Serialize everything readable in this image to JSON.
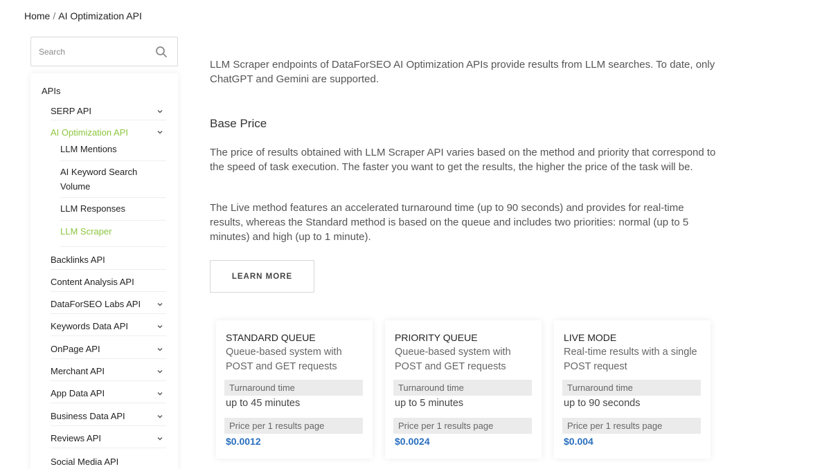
{
  "breadcrumb": {
    "home": "Home",
    "separator": "/",
    "current": "AI Optimization API"
  },
  "search": {
    "placeholder": "Search",
    "icon": "search-icon"
  },
  "sidebar": {
    "root": "APIs",
    "items": [
      {
        "label": "SERP API",
        "chevron": true
      },
      {
        "label": "AI Optimization API",
        "chevron": true,
        "active": true
      },
      {
        "label": "Backlinks API",
        "chevron": false
      },
      {
        "label": "Content Analysis API",
        "chevron": false
      },
      {
        "label": "DataForSEO Labs API",
        "chevron": true
      },
      {
        "label": "Keywords Data API",
        "chevron": true
      },
      {
        "label": "OnPage API",
        "chevron": true
      },
      {
        "label": "Merchant API",
        "chevron": true
      },
      {
        "label": "App Data API",
        "chevron": true
      },
      {
        "label": "Business Data API",
        "chevron": true
      },
      {
        "label": "Reviews API",
        "chevron": true
      },
      {
        "label": "Social Media API",
        "chevron": false
      }
    ],
    "subitems": [
      {
        "label": "LLM Mentions"
      },
      {
        "label": "AI Keyword Search Volume"
      },
      {
        "label": "LLM Responses"
      },
      {
        "label": "LLM Scraper",
        "active": true
      }
    ]
  },
  "main": {
    "intro": "LLM Scraper endpoints of DataForSEO AI Optimization APIs provide results from LLM searches. To date, only ChatGPT and Gemini are supported.",
    "heading": "Base Price",
    "paragraph1": "The price of results obtained with LLM Scraper API varies based on the method and priority that correspond to the speed of task execution. The faster you want to get the results, the higher the price of the task will be.",
    "paragraph2": "The Live method features an accelerated turnaround time (up to 90 seconds) and provides for real-time results, whereas the Standard method is based on the queue and includes two priorities: normal (up to 5 minutes) and high (up to 1 minute).",
    "learn_more": "LEARN MORE"
  },
  "cards": [
    {
      "title": "STANDARD QUEUE",
      "desc": "Queue-based system with POST and GET requests",
      "turnaround_label": "Turnaround time",
      "turnaround": "up to 45 minutes",
      "price_label": "Price per 1 results page",
      "price": "$0.0012"
    },
    {
      "title": "PRIORITY QUEUE",
      "desc": "Queue-based system with POST and GET requests",
      "turnaround_label": "Turnaround time",
      "turnaround": "up to 5 minutes",
      "price_label": "Price per 1 results page",
      "price": "$0.0024"
    },
    {
      "title": "LIVE MODE",
      "desc": "Real-time results with a single POST request",
      "turnaround_label": "Turnaround time",
      "turnaround": "up to 90 seconds",
      "price_label": "Price per 1 results page",
      "price": "$0.004"
    }
  ],
  "colors": {
    "accent_green": "#8cc63f",
    "price_blue": "#2a6fbf"
  }
}
